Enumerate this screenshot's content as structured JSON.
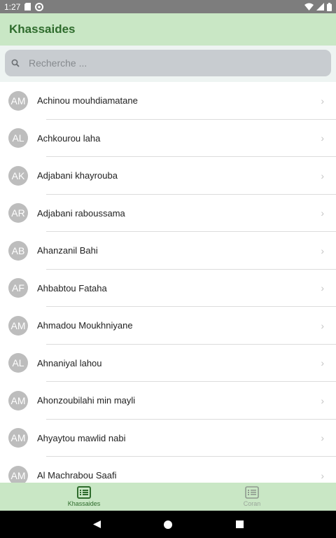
{
  "status_bar": {
    "time": "1:27",
    "icons": [
      "sd-card-icon",
      "sync-icon",
      "wifi-icon",
      "signal-icon",
      "battery-icon"
    ]
  },
  "app_bar": {
    "title": "Khassaides"
  },
  "search": {
    "placeholder": "Recherche ..."
  },
  "list": {
    "items": [
      {
        "initials": "AM",
        "label": "Achinou mouhdiamatane"
      },
      {
        "initials": "AL",
        "label": "Achkourou laha"
      },
      {
        "initials": "AK",
        "label": "Adjabani khayrouba"
      },
      {
        "initials": "AR",
        "label": "Adjabani raboussama"
      },
      {
        "initials": "AB",
        "label": "Ahanzanil Bahi"
      },
      {
        "initials": "AF",
        "label": "Ahbabtou Fataha"
      },
      {
        "initials": "AM",
        "label": "Ahmadou Moukhniyane"
      },
      {
        "initials": "AL",
        "label": "Ahnaniyal lahou"
      },
      {
        "initials": "AM",
        "label": "Ahonzoubilahi min mayli"
      },
      {
        "initials": "AM",
        "label": "Ahyaytou mawlid nabi"
      },
      {
        "initials": "AM",
        "label": "Al Machrabou Saafi"
      }
    ]
  },
  "tabs": [
    {
      "label": "Khassaides",
      "icon": "list-icon",
      "active": true
    },
    {
      "label": "Coran",
      "icon": "list-icon",
      "active": false
    }
  ],
  "nav_bar": {
    "buttons": [
      "back-icon",
      "home-icon",
      "recents-icon"
    ]
  },
  "colors": {
    "accent": "#2e6b2c",
    "app_bar_bg": "#c9e7c5",
    "avatar_bg": "#bdbdbd"
  }
}
